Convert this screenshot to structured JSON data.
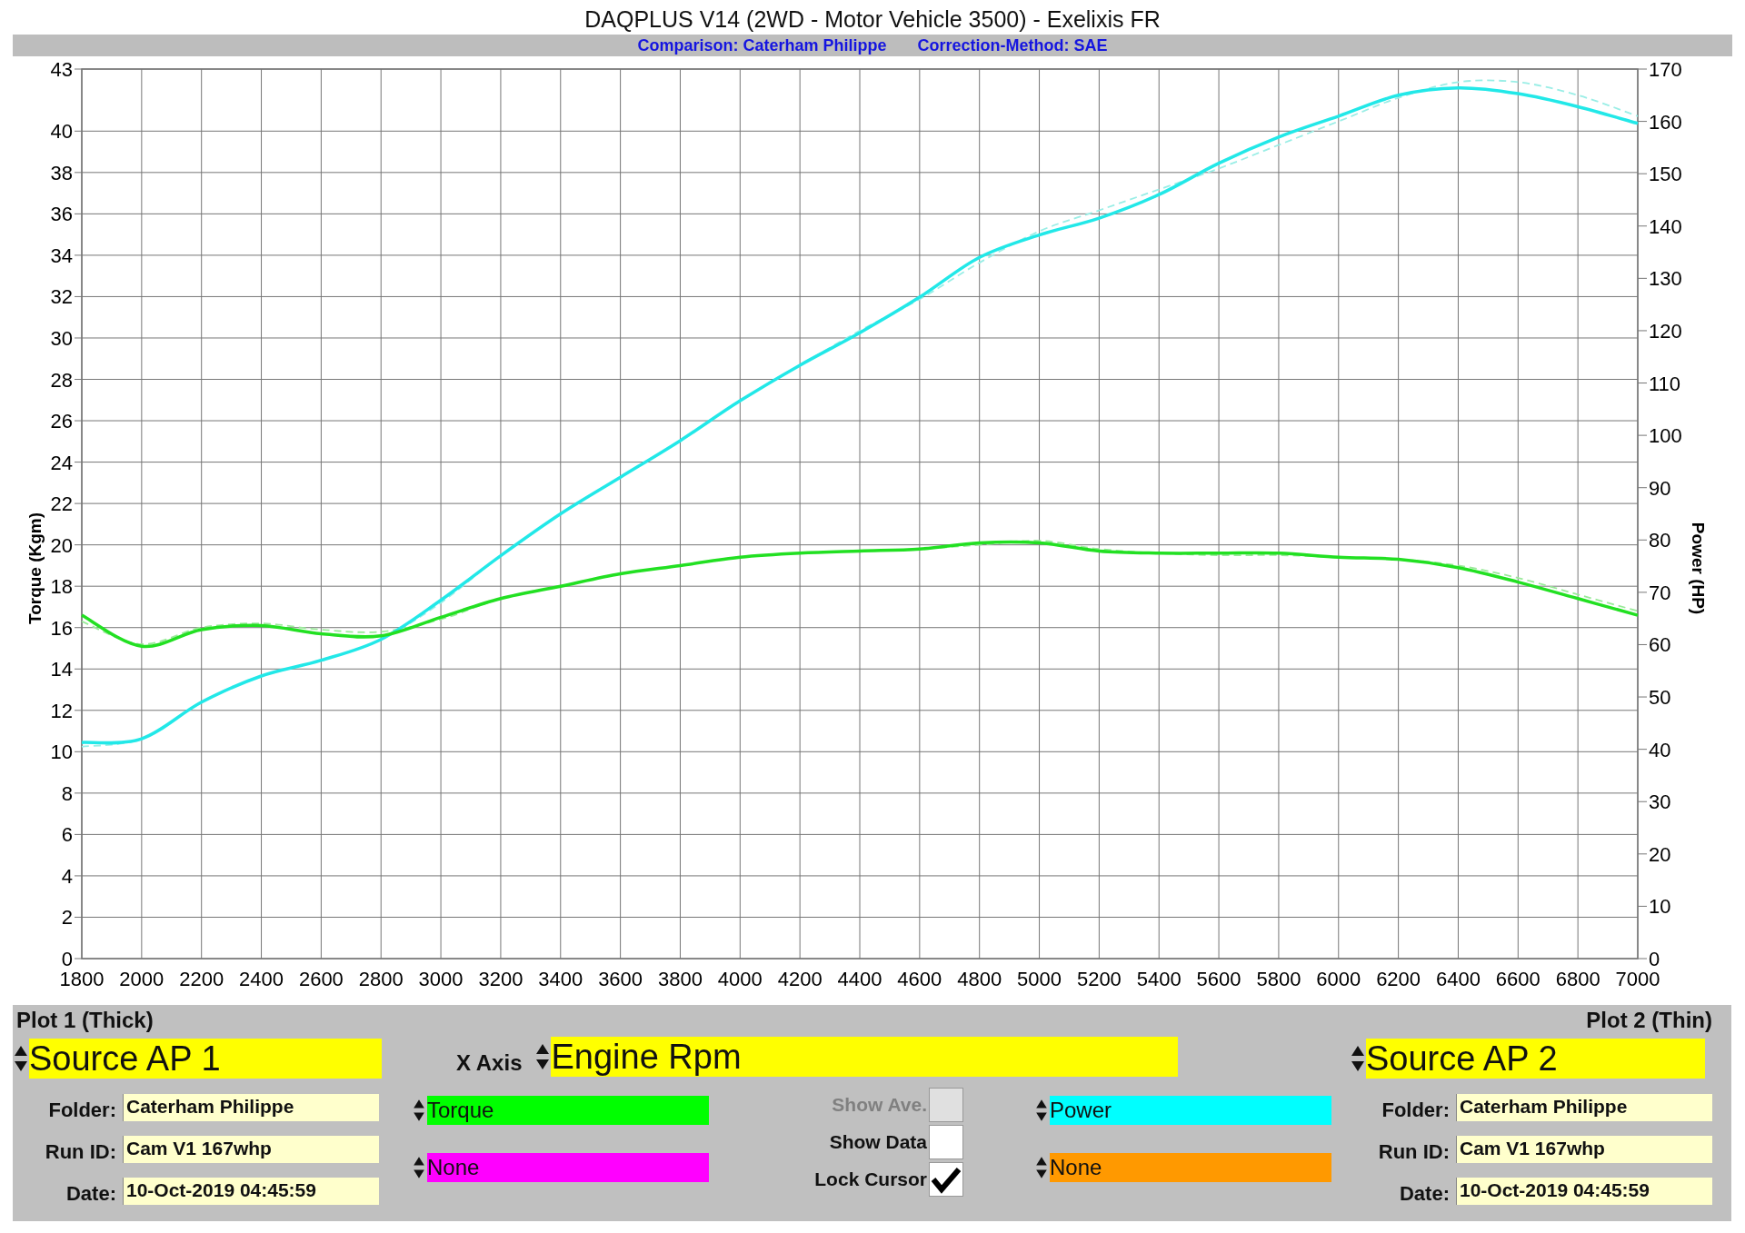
{
  "window": {
    "title": "DAQPLUS V14 (2WD - Motor Vehicle 3500) - Exelixis FR",
    "subtitle": [
      "Comparison: Caterham Philippe",
      "Correction-Method: SAE"
    ]
  },
  "chart": {
    "chart_data": {
      "type": "line",
      "ylabel": "Torque (Kgm)",
      "y2label": "Power (HP)",
      "x": [
        1800,
        2000,
        2200,
        2400,
        2600,
        2800,
        3000,
        3200,
        3400,
        3600,
        3800,
        4000,
        4200,
        4400,
        4600,
        4800,
        5000,
        5200,
        5400,
        5600,
        5800,
        6000,
        6200,
        6400,
        6600,
        6800,
        7000
      ],
      "grid": true,
      "xlim": [
        1800,
        7000
      ],
      "ylim": [
        0,
        43
      ],
      "y2lim": [
        0,
        170
      ],
      "xticks": [
        1800,
        2000,
        2200,
        2400,
        2600,
        2800,
        3000,
        3200,
        3400,
        3600,
        3800,
        4000,
        4200,
        4400,
        4600,
        4800,
        5000,
        5200,
        5400,
        5600,
        5800,
        6000,
        6200,
        6400,
        6600,
        6800,
        7000
      ],
      "yticks": [
        0,
        2,
        4,
        6,
        8,
        10,
        12,
        14,
        16,
        18,
        20,
        22,
        24,
        26,
        28,
        30,
        32,
        34,
        36,
        38,
        40,
        43
      ],
      "y2ticks": [
        0,
        10,
        20,
        30,
        40,
        50,
        60,
        70,
        80,
        90,
        100,
        110,
        120,
        130,
        140,
        150,
        160,
        170
      ],
      "series": [
        {
          "color": "#22e022",
          "line_style": "solid",
          "values": [
            16.6,
            15.1,
            15.9,
            16.1,
            15.7,
            15.6,
            16.5,
            17.4,
            18.0,
            18.6,
            19.0,
            19.4,
            19.6,
            19.7,
            19.8,
            20.1,
            20.1,
            19.7,
            19.6,
            19.6,
            19.6,
            19.4,
            19.3,
            18.9,
            18.2,
            17.4,
            16.6
          ]
        },
        {
          "color": "#22e8e8",
          "axis": "y2",
          "line_style": "solid",
          "values": [
            41.3,
            42,
            49,
            54,
            57,
            61,
            68.5,
            77,
            85,
            92,
            99,
            106.6,
            113.4,
            119.6,
            126.4,
            134,
            138.3,
            141.5,
            146,
            152,
            157,
            161,
            165,
            166.4,
            165.3,
            162.8,
            159.6
          ]
        },
        {
          "color": "#9aea9a",
          "line_style": "dashed",
          "values": [
            16.3,
            15.2,
            16.0,
            16.2,
            15.9,
            15.8,
            16.4,
            17.4,
            18.0,
            18.6,
            19.0,
            19.4,
            19.6,
            19.7,
            19.8,
            20.0,
            20.2,
            19.8,
            19.6,
            19.5,
            19.5,
            19.4,
            19.3,
            19.0,
            18.4,
            17.6,
            16.8
          ]
        },
        {
          "color": "#9aeee6",
          "axis": "y2",
          "line_style": "dashed",
          "values": [
            40.5,
            42,
            49,
            54,
            57,
            61,
            68,
            77,
            85,
            92,
            99,
            106.6,
            113.4,
            120,
            126,
            133,
            139,
            143,
            147,
            151,
            155.5,
            160,
            164.5,
            167.5,
            167.5,
            165,
            161
          ]
        }
      ]
    }
  },
  "plots": [
    {
      "label": "Plot 1 (Thick)",
      "source": "Source AP 1",
      "fields": [
        {
          "label": "Folder:",
          "value": "Caterham Philippe"
        },
        {
          "label": "Run ID:",
          "value": "Cam V1 167whp"
        },
        {
          "label": "Date:",
          "value": "10-Oct-2019 04:45:59"
        }
      ],
      "channels": [
        {
          "value": "Torque",
          "color": "#00ff00"
        },
        {
          "value": "None",
          "color": "#ff00ff"
        }
      ]
    },
    {
      "label": "Plot 2 (Thin)",
      "source": "Source AP 2",
      "fields": [
        {
          "label": "Folder:",
          "value": "Caterham Philippe"
        },
        {
          "label": "Run ID:",
          "value": "Cam V1 167whp"
        },
        {
          "label": "Date:",
          "value": "10-Oct-2019 04:45:59"
        }
      ],
      "channels": [
        {
          "value": "Power",
          "color": "#00ffff"
        },
        {
          "value": "None",
          "color": "#ff9900"
        }
      ]
    }
  ],
  "x_axis": {
    "label": "X Axis",
    "value": "Engine Rpm"
  },
  "options": [
    {
      "label": "Show Ave.",
      "checked": false,
      "disabled": true
    },
    {
      "label": "Show Data",
      "checked": false,
      "disabled": false
    },
    {
      "label": "Lock Cursor",
      "checked": true,
      "disabled": false
    }
  ]
}
